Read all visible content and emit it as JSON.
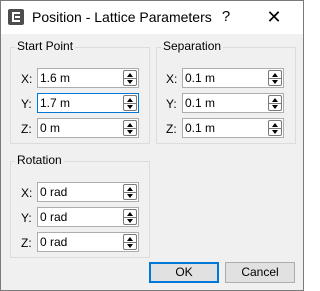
{
  "window": {
    "title": "Position - Lattice Parameters",
    "help_symbol": "?",
    "close_symbol": "✕"
  },
  "start_point": {
    "title": "Start Point",
    "x": {
      "label": "X:",
      "value": "1.6 m"
    },
    "y": {
      "label": "Y:",
      "value": "1.7 m"
    },
    "z": {
      "label": "Z:",
      "value": "0 m"
    }
  },
  "separation": {
    "title": "Separation",
    "x": {
      "label": "X:",
      "value": "0.1 m"
    },
    "y": {
      "label": "Y:",
      "value": "0.1 m"
    },
    "z": {
      "label": "Z:",
      "value": "0.1 m"
    }
  },
  "rotation": {
    "title": "Rotation",
    "x": {
      "label": "X:",
      "value": "0 rad"
    },
    "y": {
      "label": "Y:",
      "value": "0 rad"
    },
    "z": {
      "label": "Z:",
      "value": "0 rad"
    }
  },
  "buttons": {
    "ok": "OK",
    "cancel": "Cancel"
  },
  "icons": {
    "app": "app-icon",
    "help": "help-icon",
    "close": "close-icon",
    "spin_up": "chevron-up-icon",
    "spin_down": "chevron-down-icon"
  },
  "colors": {
    "focus_accent": "#0078d7",
    "dialog_background": "#f0f0f0"
  }
}
